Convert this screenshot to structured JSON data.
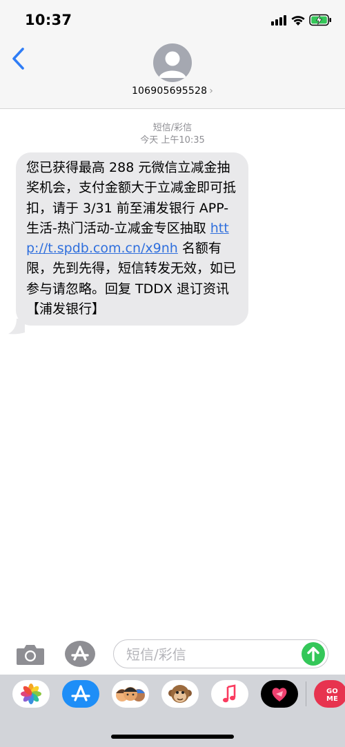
{
  "status_bar": {
    "time": "10:37",
    "icons": [
      "signal-icon",
      "wifi-icon",
      "battery-charging-icon"
    ]
  },
  "header": {
    "back_icon": "chevron-left-icon",
    "contact_number": "106905695528",
    "contact_chevron": "›"
  },
  "conversation": {
    "message_type": "短信/彩信",
    "timestamp": "今天 上午10:35",
    "messages": [
      {
        "direction": "incoming",
        "text_before_link": "您已获得最高 288 元微信立减金抽奖机会，支付金额大于立减金即可抵扣，请于 3/31 前至浦发银行 APP-生活-热门活动-立减金专区抽取 ",
        "link": "http://t.spdb.com.cn/x9nh",
        "text_after_link": " 名额有限，先到先得，短信转发无效，如已参与请忽略。回复 TDDX 退订资讯【浦发银行】"
      }
    ]
  },
  "composer": {
    "placeholder": "短信/彩信",
    "value": "",
    "camera_icon": "camera-icon",
    "apps_icon": "app-store-icon",
    "send_icon": "send-arrow-icon",
    "send_color": "#34c759"
  },
  "app_drawer": {
    "apps": [
      "photos-icon",
      "app-store-icon",
      "memoji-icon",
      "animoji-monkey-icon",
      "music-icon",
      "digital-touch-icon",
      "gamepigeon-icon"
    ],
    "partial_app_label": "GO ME"
  },
  "colors": {
    "link": "#2f6fdd",
    "bubble": "#e9e9eb",
    "header_bg": "#f6f6f6",
    "drawer_bg": "#d2d4d9"
  }
}
